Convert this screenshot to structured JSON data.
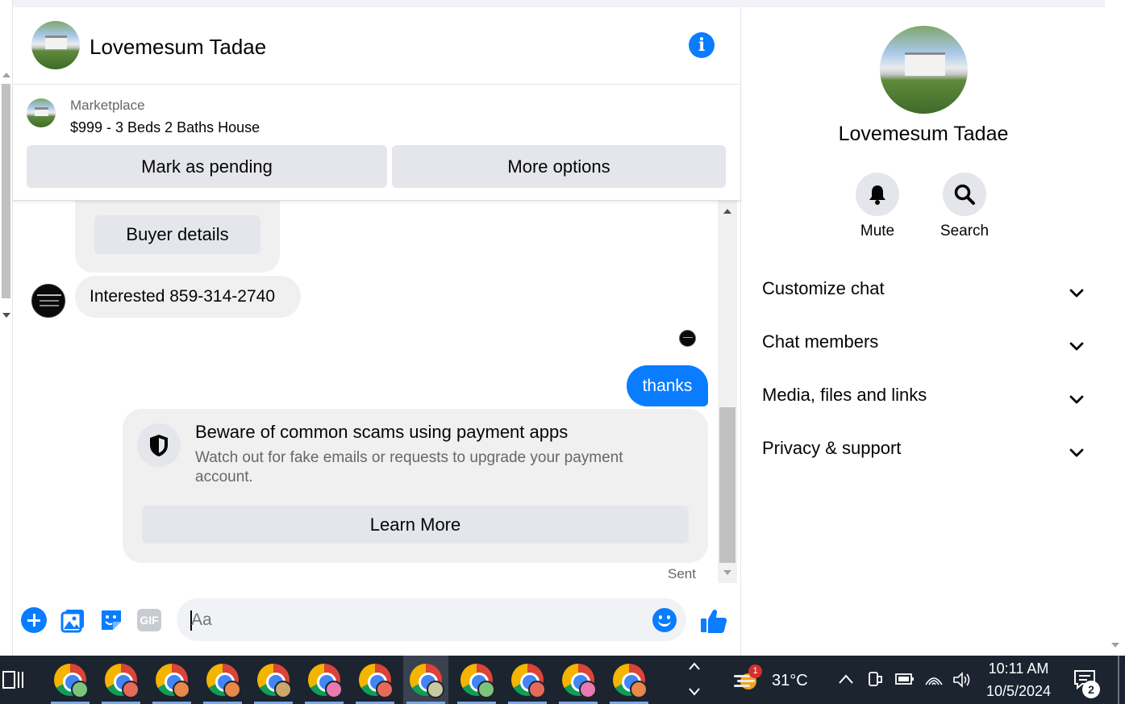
{
  "colors": {
    "accent": "#0a7cff",
    "taskbar": "#1c2430"
  },
  "chat_header": {
    "name": "Lovemesum Tadae"
  },
  "marketplace": {
    "label": "Marketplace",
    "listing_title": "$999 - 3 Beds 2 Baths House",
    "mark_pending_label": "Mark as pending",
    "more_options_label": "More options"
  },
  "messages": {
    "buyer_details_label": "Buyer details",
    "incoming_text": "Interested 859-314-2740",
    "outgoing_text": "thanks",
    "scam_warning": {
      "title": "Beware of common scams using payment apps",
      "body": "Watch out for fake emails or requests to upgrade your payment account.",
      "learn_more_label": "Learn More"
    },
    "status": "Sent"
  },
  "composer": {
    "placeholder": "Aa",
    "icons": [
      "plus-icon",
      "photo-icon",
      "sticker-icon",
      "gif-icon",
      "emoji-icon",
      "like-icon"
    ],
    "gif_label": "GIF"
  },
  "right_panel": {
    "name": "Lovemesum Tadae",
    "mute_label": "Mute",
    "search_label": "Search",
    "sections": [
      {
        "label": "Customize chat"
      },
      {
        "label": "Chat members"
      },
      {
        "label": "Media, files and links"
      },
      {
        "label": "Privacy & support"
      }
    ]
  },
  "taskbar": {
    "weather_temp": "31°C",
    "weather_badge": "1",
    "time": "10:11 AM",
    "date": "10/5/2024",
    "notification_count": "2",
    "profile_colors": [
      "#7cc47a",
      "#e66a5a",
      "#e8884a",
      "#e8884a",
      "#c9a86a",
      "#e87ab0",
      "#e66a5a",
      "#c9c9a0",
      "#7cc47a",
      "#e66a5a",
      "#e87ab0",
      "#e8884a"
    ]
  }
}
